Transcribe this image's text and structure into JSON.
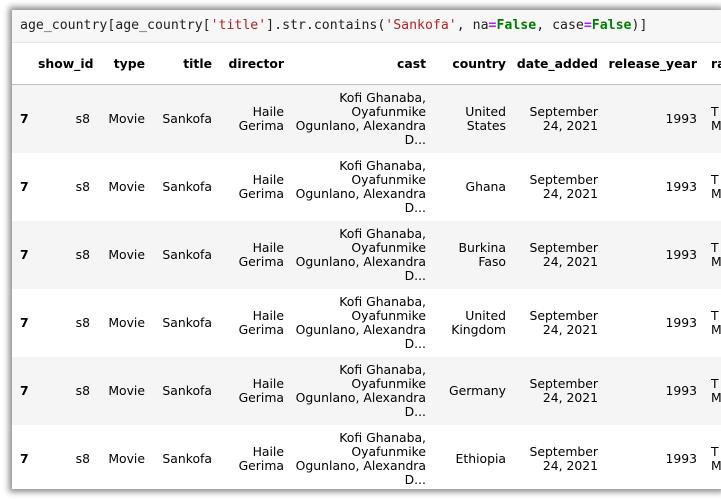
{
  "code": {
    "var": "age_country",
    "lb1": "[",
    "var2": "age_country",
    "lb2": "[",
    "key": "'title'",
    "rb2": "]",
    "method": ".str.contains(",
    "arg": "'Sankofa'",
    "sep1": ", ",
    "na_kw": "na",
    "eq1": "=",
    "false1": "False",
    "sep2": ", ",
    "case_kw": "case",
    "eq2": "=",
    "false2": "False",
    "close": ")]"
  },
  "table": {
    "columns": [
      "",
      "show_id",
      "type",
      "title",
      "director",
      "cast",
      "country",
      "date_added",
      "release_year",
      "rati"
    ],
    "rows": [
      {
        "index": "7",
        "show_id": "s8",
        "type": "Movie",
        "title": "Sankofa",
        "director": "Haile Gerima",
        "cast": "Kofi Ghanaba, Oyafunmike Ogunlano, Alexandra D...",
        "country": "United States",
        "date_added": "September 24, 2021",
        "release_year": "1993",
        "rating": "T\nM"
      },
      {
        "index": "7",
        "show_id": "s8",
        "type": "Movie",
        "title": "Sankofa",
        "director": "Haile Gerima",
        "cast": "Kofi Ghanaba, Oyafunmike Ogunlano, Alexandra D...",
        "country": "Ghana",
        "date_added": "September 24, 2021",
        "release_year": "1993",
        "rating": "T\nM"
      },
      {
        "index": "7",
        "show_id": "s8",
        "type": "Movie",
        "title": "Sankofa",
        "director": "Haile Gerima",
        "cast": "Kofi Ghanaba, Oyafunmike Ogunlano, Alexandra D...",
        "country": "Burkina Faso",
        "date_added": "September 24, 2021",
        "release_year": "1993",
        "rating": "T\nM"
      },
      {
        "index": "7",
        "show_id": "s8",
        "type": "Movie",
        "title": "Sankofa",
        "director": "Haile Gerima",
        "cast": "Kofi Ghanaba, Oyafunmike Ogunlano, Alexandra D...",
        "country": "United Kingdom",
        "date_added": "September 24, 2021",
        "release_year": "1993",
        "rating": "T\nM"
      },
      {
        "index": "7",
        "show_id": "s8",
        "type": "Movie",
        "title": "Sankofa",
        "director": "Haile Gerima",
        "cast": "Kofi Ghanaba, Oyafunmike Ogunlano, Alexandra D...",
        "country": "Germany",
        "date_added": "September 24, 2021",
        "release_year": "1993",
        "rating": "T\nM"
      },
      {
        "index": "7",
        "show_id": "s8",
        "type": "Movie",
        "title": "Sankofa",
        "director": "Haile Gerima",
        "cast": "Kofi Ghanaba, Oyafunmike Ogunlano, Alexandra D...",
        "country": "Ethiopia",
        "date_added": "September 24, 2021",
        "release_year": "1993",
        "rating": "T\nM"
      }
    ]
  }
}
